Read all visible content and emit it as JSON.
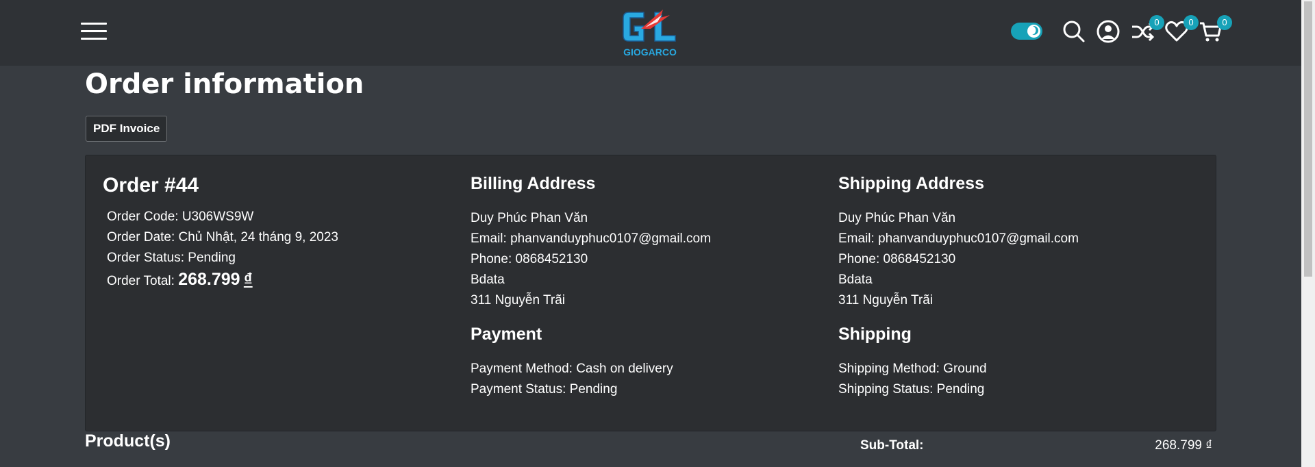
{
  "header": {
    "logo_text": "GIOGARCO",
    "badges": {
      "compare": "0",
      "wishlist": "0",
      "cart": "0"
    },
    "icons": [
      "menu-icon",
      "theme-toggle",
      "search-icon",
      "user-icon",
      "shuffle-icon",
      "heart-icon",
      "cart-icon"
    ]
  },
  "page": {
    "title": "Order information",
    "pdf_button": "PDF Invoice"
  },
  "order": {
    "title": "Order #44",
    "code": "Order Code: U306WS9W",
    "date": "Order Date: Chủ Nhật, 24 tháng 9, 2023",
    "status": "Order Status: Pending",
    "total_label": "Order Total:",
    "total_value": "268.799",
    "total_currency": "₫"
  },
  "billing": {
    "title": "Billing Address",
    "name": "Duy Phúc Phan Văn",
    "email": "Email: phanvanduyphuc0107@gmail.com",
    "phone": "Phone: 0868452130",
    "company": "Bdata",
    "address": "311 Nguyễn Trãi"
  },
  "shipping_address": {
    "title": "Shipping Address",
    "name": "Duy Phúc Phan Văn",
    "email": "Email: phanvanduyphuc0107@gmail.com",
    "phone": "Phone: 0868452130",
    "company": "Bdata",
    "address": "311 Nguyễn Trãi"
  },
  "payment": {
    "title": "Payment",
    "method": "Payment Method: Cash on delivery",
    "status": "Payment Status: Pending"
  },
  "shipping": {
    "title": "Shipping",
    "method": "Shipping Method: Ground",
    "status": "Shipping Status: Pending"
  },
  "products": {
    "title": "Product(s)",
    "subtotal_label": "Sub-Total:",
    "subtotal_value": "268.799 ₫"
  },
  "colors": {
    "header_bg": "#2f3236",
    "page_bg": "#383c41",
    "card_bg": "#2c2e31",
    "accent": "#17a2b8"
  }
}
